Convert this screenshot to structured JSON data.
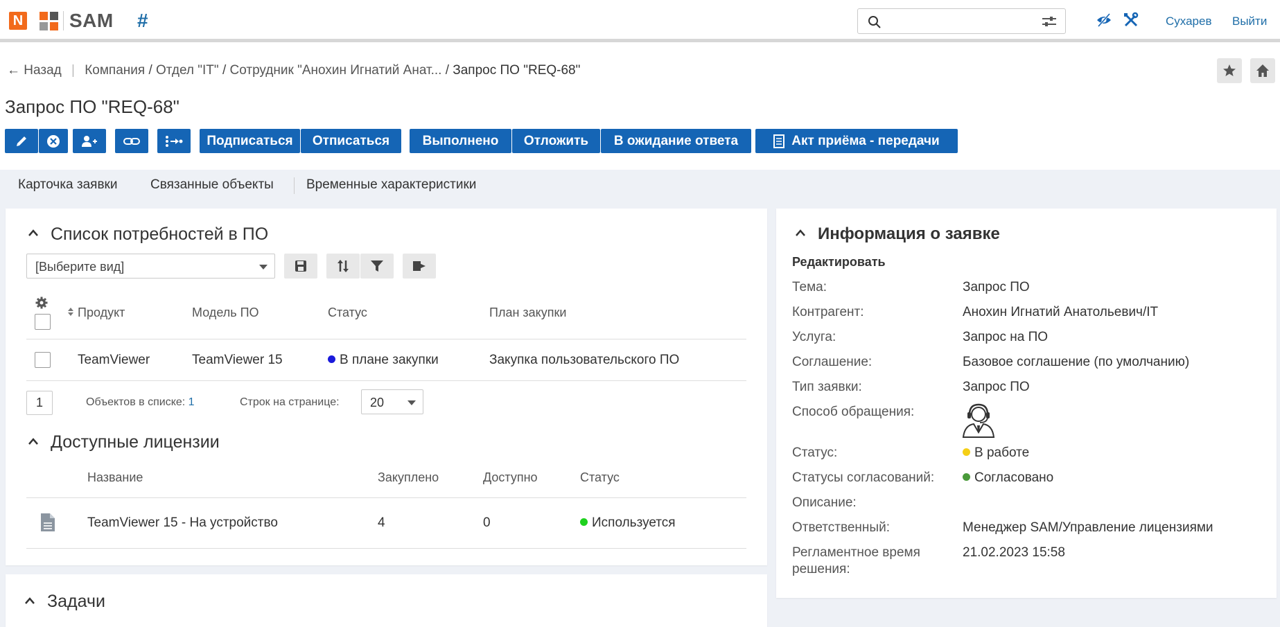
{
  "header": {
    "logo_letter": "N",
    "app_name": "SAM",
    "search_placeholder": "",
    "user": "Сухарев",
    "logout": "Выйти"
  },
  "breadcrumb": {
    "back": "Назад",
    "items": [
      "Компания",
      "Отдел \"IT\"",
      "Сотрудник \"Анохин Игнатий Анат...",
      "Запрос ПО \"REQ-68\""
    ]
  },
  "page_title": "Запрос ПО \"REQ-68\"",
  "toolbar": {
    "subscribe": "Подписаться",
    "unsubscribe": "Отписаться",
    "done": "Выполнено",
    "postpone": "Отложить",
    "waiting": "В ожидание ответа",
    "act": "Акт приёма - передачи"
  },
  "tabs": [
    "Карточка заявки",
    "Связанные объекты",
    "Временные характеристики"
  ],
  "needs": {
    "title": "Список потребностей в ПО",
    "view_select": "[Выберите вид]",
    "columns": [
      "Продукт",
      "Модель ПО",
      "Статус",
      "План закупки"
    ],
    "rows": [
      {
        "product": "TeamViewer",
        "model": "TeamViewer 15",
        "status": "В плане закупки",
        "status_color": "#1a1adb",
        "plan": "Закупка пользовательского ПО"
      }
    ],
    "page": "1",
    "count_label": "Объектов в списке:",
    "count": "1",
    "rows_label": "Строк на странице:",
    "rows_per_page": "20"
  },
  "licenses": {
    "title": "Доступные лицензии",
    "columns": [
      "Название",
      "Закуплено",
      "Доступно",
      "Статус"
    ],
    "rows": [
      {
        "name": "TeamViewer 15 - На устройство",
        "bought": "4",
        "available": "0",
        "status": "Используется",
        "status_color": "#1ed11e"
      }
    ]
  },
  "tasks": {
    "title": "Задачи"
  },
  "info": {
    "title": "Информация о заявке",
    "edit": "Редактировать",
    "fields": {
      "theme_label": "Тема:",
      "theme": "Запрос ПО",
      "contractor_label": "Контрагент:",
      "contractor": "Анохин Игнатий Анатольевич/IT",
      "service_label": "Услуга:",
      "service": "Запрос на ПО",
      "agreement_label": "Соглашение:",
      "agreement": "Базовое соглашение (по умолчанию)",
      "type_label": "Тип заявки:",
      "type": "Запрос ПО",
      "method_label": "Способ обращения:",
      "status_label": "Статус:",
      "status": "В работе",
      "status_color": "#f5cf16",
      "approval_label": "Статусы согласований:",
      "approval": "Согласовано",
      "approval_color": "#4a9a3a",
      "desc_label": "Описание:",
      "responsible_label": "Ответственный:",
      "responsible": "Менеджер SAM/Управление лицензиями",
      "deadline_label_1": "Регламентное время",
      "deadline_label_2": "решения:",
      "deadline": "21.02.2023 15:58"
    }
  }
}
